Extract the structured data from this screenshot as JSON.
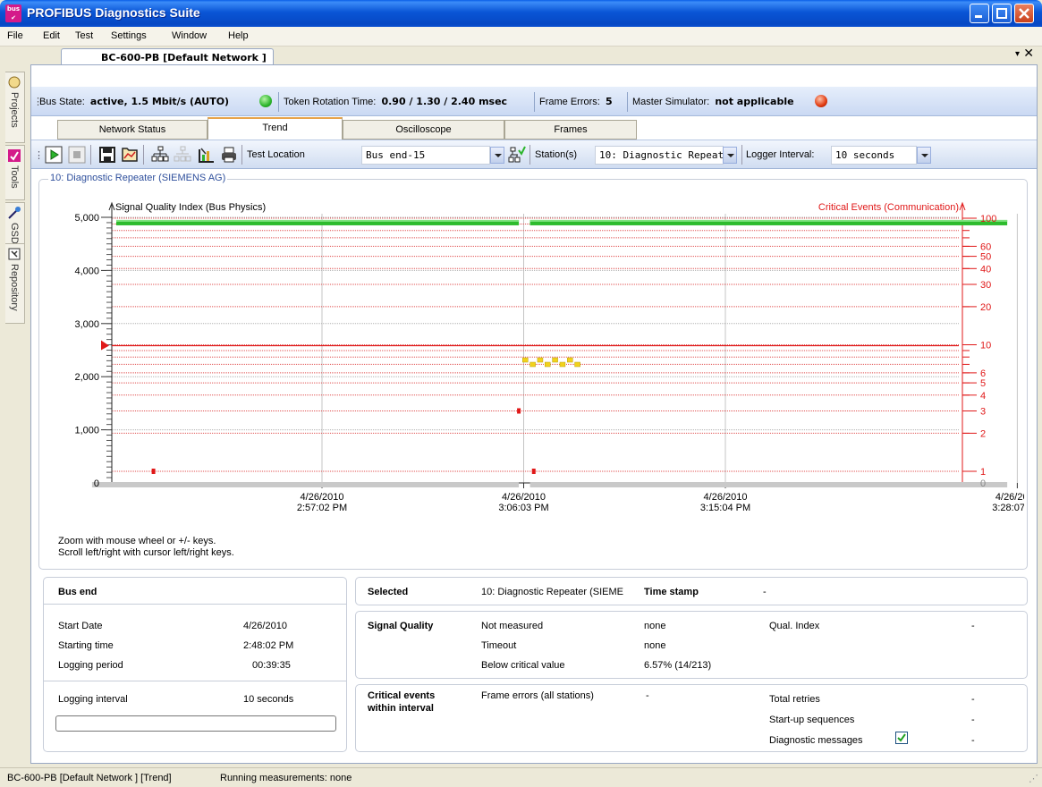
{
  "window": {
    "title": "PROFIBUS Diagnostics Suite",
    "logo_text": "bus"
  },
  "menu": [
    "File",
    "Edit",
    "Test",
    "Settings",
    "Window",
    "Help"
  ],
  "dock": {
    "items": [
      "Projects",
      "Tools",
      "GSD",
      "Repository"
    ]
  },
  "document": {
    "tab": "BC-600-PB [Default Network ]",
    "menu_arrow": "▾",
    "close": "✕"
  },
  "busbar": {
    "bus_state_label": "Bus State:",
    "bus_state_value": "active, 1.5 Mbit/s (AUTO)",
    "token_label": "Token Rotation Time:",
    "token_value": "0.90 / 1.30 / 2.40 msec",
    "frame_errors_label": "Frame Errors:",
    "frame_errors_value": "5",
    "master_label": "Master Simulator:",
    "master_value": "not applicable",
    "colors": {
      "bus_state_led": "#2cb52c",
      "master_led": "#e03a10"
    }
  },
  "view_tabs": [
    "Network Status",
    "Trend",
    "Oscilloscope",
    "Frames"
  ],
  "active_view_tab": "Trend",
  "toolbar": {
    "icons": [
      "play-icon",
      "stop-icon",
      "save-icon",
      "open-chart-icon",
      "find-stations-icon",
      "network-scan-icon",
      "signal-icon",
      "print-icon",
      "station-select-icon"
    ],
    "test_location_label": "Test Location",
    "test_location_value": "Bus end-15",
    "stations_label": "Station(s)",
    "stations_value": "10: Diagnostic Repeat\u0010",
    "logger_label": "Logger Interval:",
    "logger_value": "10 seconds"
  },
  "chart_group_title": "10: Diagnostic Repeater (SIEMENS AG)",
  "chart_data": {
    "type": "line",
    "left_axis_label": "Signal Quality Index (Bus Physics)",
    "right_axis_label": "Critical Events (Communication)",
    "left_ticks": [
      {
        "v": 0,
        "t": "0"
      },
      {
        "v": 1000,
        "t": "1,000"
      },
      {
        "v": 2000,
        "t": "2,000"
      },
      {
        "v": 3000,
        "t": "3,000"
      },
      {
        "v": 4000,
        "t": "4,000"
      },
      {
        "v": 5000,
        "t": "5,000"
      }
    ],
    "ylim": [
      0,
      5000
    ],
    "threshold_marker": 2600,
    "right_ticks": [
      "0",
      "1",
      "2",
      "3",
      "4",
      "5",
      "6",
      "10",
      "20",
      "30",
      "40",
      "50",
      "60",
      "100"
    ],
    "right_gridlines": [
      1,
      2,
      3,
      4,
      5,
      6,
      7,
      8,
      9,
      10,
      20,
      30,
      40,
      50,
      60,
      70,
      80,
      90,
      100
    ],
    "x_ticks": [
      {
        "date": "4/26/2010",
        "time": "2:57:02 PM"
      },
      {
        "date": "4/26/2010",
        "time": "3:06:03 PM"
      },
      {
        "date": "4/26/2010",
        "time": "3:15:04 PM"
      },
      {
        "date": "4/26/2010",
        "time": "3:28:07 PM"
      }
    ],
    "signal_quality_segments": [
      {
        "from": "2:48:02 PM",
        "to": "3:05:50 PM",
        "value": 4900
      },
      {
        "from": "3:06:20 PM",
        "to": "3:27:40 PM",
        "value": 4900
      }
    ],
    "critical_events": [
      {
        "time": "2:49:30 PM",
        "count": 1
      },
      {
        "time": "3:05:50 PM",
        "count": 3
      },
      {
        "time": "3:06:30 PM",
        "count": 1
      }
    ],
    "diagnostic_markers": {
      "from": "3:06:00 PM",
      "to": "3:08:20 PM",
      "count": 8
    },
    "colors": {
      "signal": "#2dbb2d",
      "events": "#e01818",
      "markers": "#f2d21a",
      "grid": "#e05050"
    }
  },
  "hints": [
    "Zoom with mouse wheel or +/- keys.",
    "Scroll left/right with cursor left/right keys."
  ],
  "bus_end_panel": {
    "title": "Bus end",
    "rows": [
      {
        "label": "Start Date",
        "value": "4/26/2010"
      },
      {
        "label": "Starting time",
        "value": "2:48:02 PM"
      },
      {
        "label": "Logging period",
        "value": "00:39:35"
      }
    ],
    "interval_label": "Logging interval",
    "interval_value": "10 seconds",
    "progress": 0
  },
  "selected_panel": {
    "label": "Selected",
    "value": "10: Diagnostic Repeater (SIEME",
    "timestamp_label": "Time stamp",
    "timestamp_value": "-"
  },
  "signal_quality_panel": {
    "title": "Signal Quality",
    "rows": [
      {
        "label": "Not measured",
        "value": "none"
      },
      {
        "label": "Timeout",
        "value": "none"
      },
      {
        "label": "Below critical value",
        "value": "6.57% (14/213)"
      }
    ],
    "qual_label": "Qual. Index",
    "qual_value": "-"
  },
  "critical_panel": {
    "title_line1": "Critical events",
    "title_line2": "within interval",
    "frame_errors_label": "Frame errors (all stations)",
    "frame_errors_value": "-",
    "rows": [
      {
        "label": "Total retries",
        "value": "-"
      },
      {
        "label": "Start-up sequences",
        "value": "-"
      },
      {
        "label": "Diagnostic messages",
        "value": "-"
      }
    ],
    "diagnostic_checked": true
  },
  "statusbar": {
    "left": "BC-600-PB [Default Network ] [Trend]",
    "right": "Running measurements: none"
  }
}
